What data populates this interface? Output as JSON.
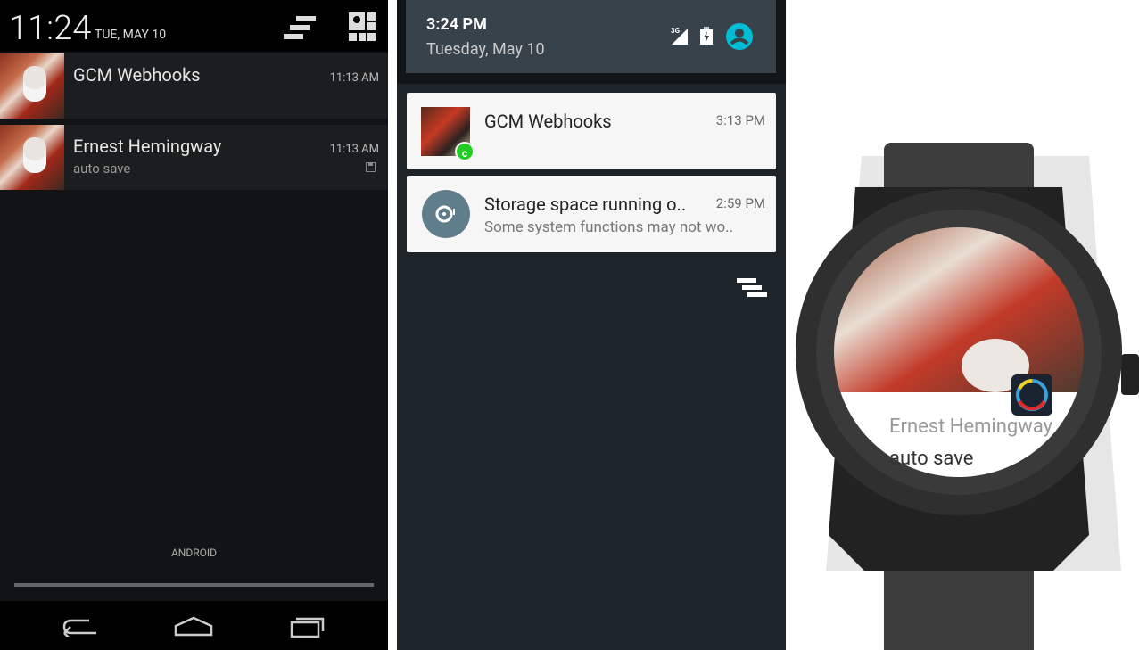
{
  "phone_left": {
    "status": {
      "time": "11:24",
      "date": "TUE, MAY 10"
    },
    "notifications": [
      {
        "title": "GCM Webhooks",
        "subtitle": "",
        "time": "11:13 AM"
      },
      {
        "title": "Ernest Hemingway",
        "subtitle": "auto save",
        "time": "11:13 AM",
        "icon": "save-icon"
      }
    ],
    "carrier": "ANDROID",
    "nav": [
      "back-icon",
      "home-icon",
      "recents-icon"
    ]
  },
  "phone_right": {
    "header": {
      "time": "3:24 PM",
      "date": "Tuesday, May 10",
      "network": "3G"
    },
    "notifications": [
      {
        "title": "GCM Webhooks",
        "subtitle": "",
        "time": "3:13 PM",
        "badge": "c",
        "badge_color": "#22cc22"
      },
      {
        "title": "Storage space running o..",
        "subtitle": "Some system functions may not wo..",
        "time": "2:59 PM"
      }
    ],
    "accent": "#00bcd4"
  },
  "watch": {
    "title": "Ernest Hemingway",
    "text": "auto save"
  }
}
